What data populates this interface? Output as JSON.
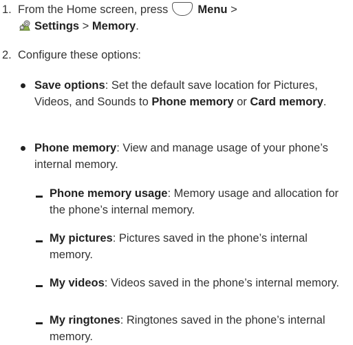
{
  "steps": [
    {
      "number": "1.",
      "prefix": "From the Home screen, press ",
      "menu_label": "Menu",
      "separator1": " >",
      "settings_label": "Settings",
      "separator2": " > ",
      "memory_label": "Memory",
      "suffix": "."
    },
    {
      "number": "2.",
      "text": "Configure these options:"
    }
  ],
  "bullets": [
    {
      "term": "Save options",
      "desc_part1": ": Set the default save location for Pictures, Videos, and Sounds to ",
      "opt1": "Phone memory",
      "mid": " or ",
      "opt2": "Card memory",
      "end": "."
    },
    {
      "term": "Phone memory",
      "desc": ": View and manage usage of your phone’s internal memory."
    }
  ],
  "subitems": [
    {
      "term": "Phone memory usage",
      "desc": ": Memory usage and allocation for the phone’s internal memory."
    },
    {
      "term": "My pictures",
      "desc": ": Pictures saved in the phone’s internal memory."
    },
    {
      "term": "My videos",
      "desc": ": Videos saved in the phone’s internal memory."
    },
    {
      "term": "My ringtones",
      "desc": ": Ringtones saved in the phone’s internal memory."
    }
  ],
  "icons": {
    "menu_key": "menu-key-icon",
    "settings": "settings-gear-icon"
  }
}
